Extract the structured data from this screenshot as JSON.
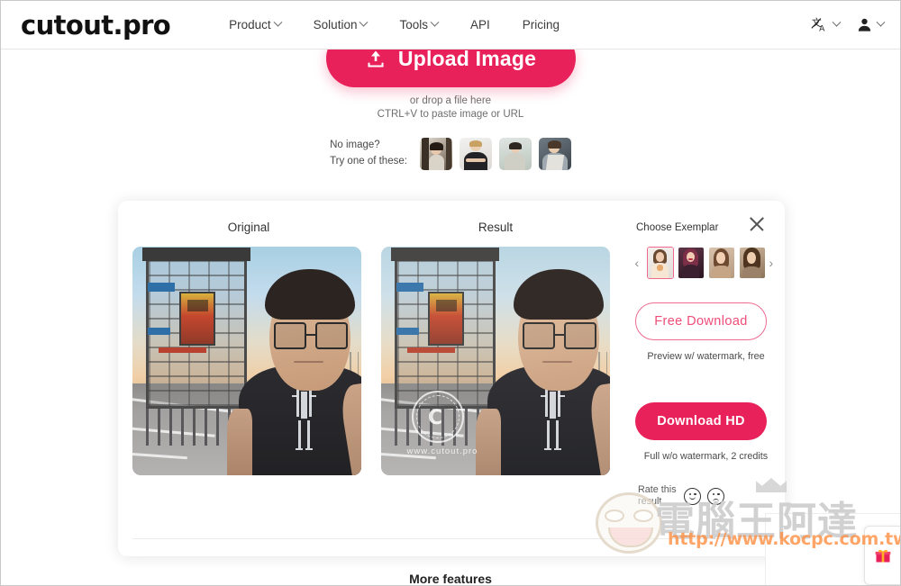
{
  "header": {
    "logo": "cutout.pro",
    "nav": [
      {
        "label": "Product",
        "has_chevron": true
      },
      {
        "label": "Solution",
        "has_chevron": true
      },
      {
        "label": "Tools",
        "has_chevron": true
      },
      {
        "label": "API",
        "has_chevron": false
      },
      {
        "label": "Pricing",
        "has_chevron": false
      }
    ],
    "language_icon": "translate-icon",
    "account_icon": "user-icon"
  },
  "upload": {
    "button_label": "Upload Image",
    "button_icon": "upload-icon",
    "hint_line1": "or drop a file here",
    "hint_line2": "CTRL+V to paste image or URL",
    "accent_color": "#e8215a"
  },
  "samples": {
    "prompt_line1": "No image?",
    "prompt_line2": "Try one of these:",
    "thumbnails": [
      {
        "name": "sample-thumb-1",
        "alt": "woman in doorway"
      },
      {
        "name": "sample-thumb-2",
        "alt": "woman arms crossed"
      },
      {
        "name": "sample-thumb-3",
        "alt": "woman outdoors"
      },
      {
        "name": "sample-thumb-4",
        "alt": "woman with scarf"
      }
    ]
  },
  "card": {
    "original_label": "Original",
    "result_label": "Result",
    "close_icon": "close-icon",
    "original_alt": "selfie of man with glasses in front of industrial crane",
    "result_alt": "stylized portrait result of same selfie",
    "result_watermark_letter": "C",
    "result_watermark_url": "www.cutout.pro"
  },
  "rail": {
    "exemplar_label": "Choose Exemplar",
    "prev_icon": "chevron-left-icon",
    "next_icon": "chevron-right-icon",
    "exemplars": [
      {
        "name": "exemplar-1",
        "selected": true
      },
      {
        "name": "exemplar-2",
        "selected": false
      },
      {
        "name": "exemplar-3",
        "selected": false
      },
      {
        "name": "exemplar-4",
        "selected": false
      }
    ],
    "free_download_label": "Free Download",
    "free_download_note": "Preview w/ watermark, free",
    "hd_download_label": "Download HD",
    "hd_download_note": "Full w/o watermark, 2 credits",
    "rate_label": "Rate this result",
    "rate_happy_icon": "happy-face-icon",
    "rate_sad_icon": "sad-face-icon",
    "free_button_color": "#ef4c77",
    "hd_button_color": "#e8215a"
  },
  "footer": {
    "more_features": "More features"
  },
  "watermark": {
    "text": "電腦王阿達",
    "url": "http://www.kocpc.com.tw",
    "mascot_icon": "cartoon-face-icon"
  },
  "widget": {
    "gift_icon": "gift-icon"
  }
}
